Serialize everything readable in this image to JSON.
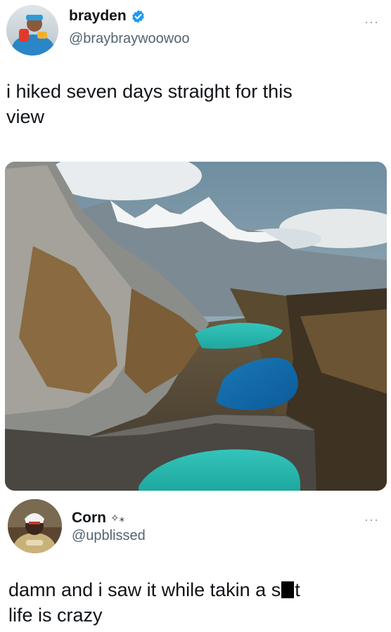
{
  "tweet": {
    "author_name": "brayden",
    "handle": "@braybraywoowoo",
    "verified": true,
    "text": "i hiked seven days straight for this\nview",
    "media": {
      "description_icon": "landscape-photo"
    }
  },
  "reply": {
    "author_name": "Corn",
    "name_emojis": "✧⁎",
    "handle": "@upblissed",
    "text_before": "damn and i saw it while takin a s",
    "text_after": "t",
    "text_line2": "life is crazy"
  },
  "icons": {
    "more": "more-horizontal-icon",
    "verified": "verified-badge-icon"
  },
  "colors": {
    "verified": "#1d9bf0",
    "handle": "#536471",
    "text": "#0f1419"
  }
}
